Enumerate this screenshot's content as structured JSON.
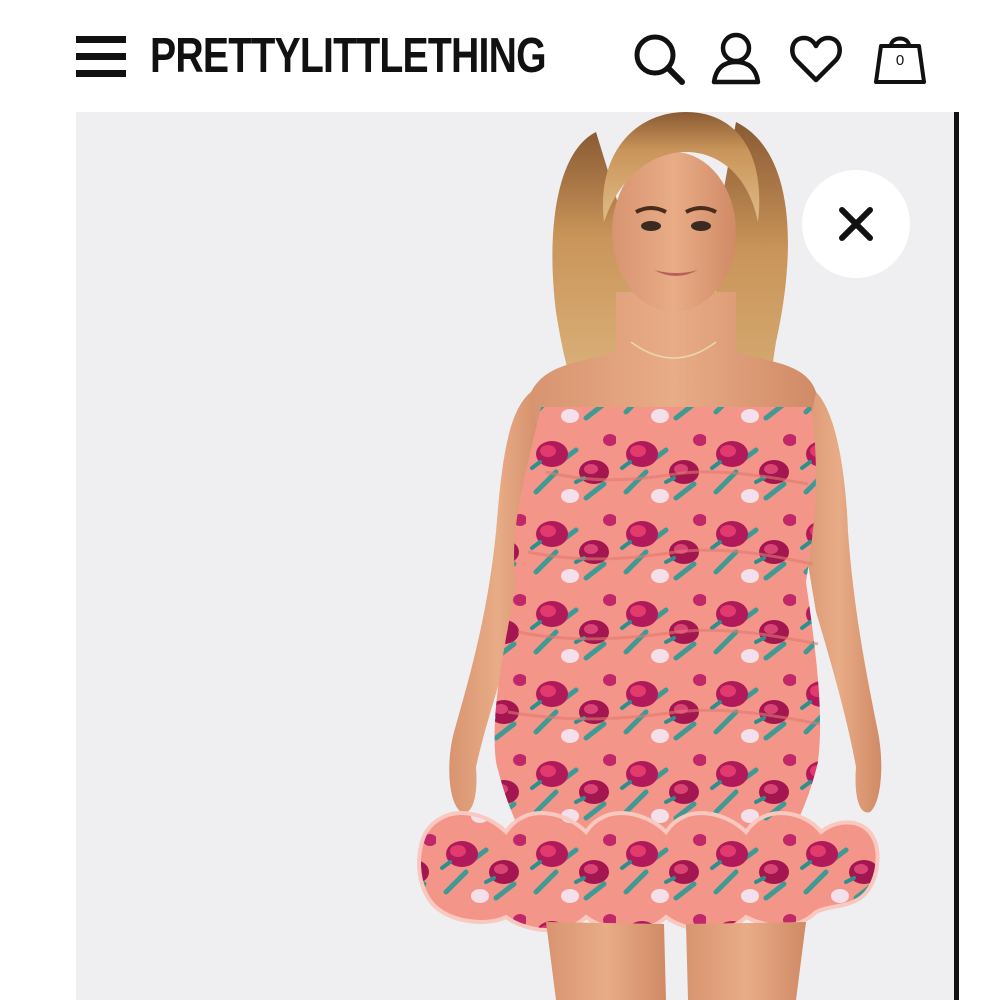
{
  "header": {
    "logo_text": "PRETTYLITTLETHING",
    "menu_icon": "hamburger-menu-icon",
    "search_icon": "search-icon",
    "account_icon": "account-icon",
    "wishlist_icon": "heart-icon",
    "bag_icon": "shopping-bag-icon",
    "bag_count": "0"
  },
  "product": {
    "close_icon": "close-icon",
    "colors": {
      "background": "#efeff1",
      "dress_base": "#f4958a",
      "flower_primary": "#b0195a",
      "flower_secondary": "#e33a6d",
      "leaf": "#3f9a94",
      "hair": "#c9955a",
      "skin": "#e2a27e"
    }
  }
}
